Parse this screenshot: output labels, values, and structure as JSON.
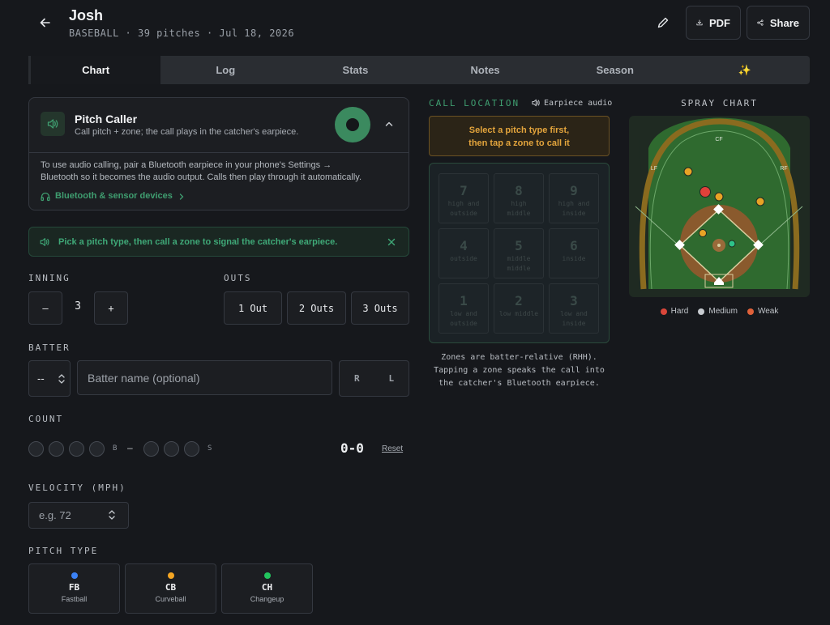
{
  "header": {
    "title": "Josh",
    "subtitle": "BASEBALL · 39 pitches · Jul 18, 2026",
    "pdf_label": "PDF",
    "share_label": "Share"
  },
  "tabs": [
    {
      "label": "Chart",
      "active": true
    },
    {
      "label": "Log"
    },
    {
      "label": "Stats"
    },
    {
      "label": "Notes"
    },
    {
      "label": "Season"
    },
    {
      "label": "✨"
    }
  ],
  "pitch_caller": {
    "title": "Pitch Caller",
    "subtitle": "Call pitch + zone; the call plays in the catcher's earpiece.",
    "body_line1": "To use audio calling, pair a Bluetooth earpiece in your phone's Settings →",
    "body_line2": "Bluetooth so it becomes the audio output. Calls then play through it automatically.",
    "bt_link": "Bluetooth & sensor devices"
  },
  "hint": {
    "text": "Pick a pitch type, then call a zone to signal the catcher's earpiece."
  },
  "inning": {
    "label": "INNING",
    "minus": "–",
    "value": "3",
    "plus": "+"
  },
  "outs": {
    "label": "OUTS",
    "options": [
      "1 Out",
      "2 Outs",
      "3 Outs"
    ]
  },
  "batter": {
    "label": "BATTER",
    "select_value": "--",
    "placeholder": "Batter name (optional)",
    "hand_r": "R",
    "hand_l": "L"
  },
  "count": {
    "label": "COUNT",
    "balls_letter": "B",
    "dash": "–",
    "strikes_letter": "S",
    "value": "0-0",
    "reset": "Reset"
  },
  "velocity": {
    "label": "VELOCITY (MPH)",
    "placeholder": "e.g. 72"
  },
  "pitch_type": {
    "label": "PITCH TYPE",
    "types": [
      {
        "code": "FB",
        "name": "Fastball",
        "color": "#3b82f6"
      },
      {
        "code": "CB",
        "name": "Curveball",
        "color": "#f5a623"
      },
      {
        "code": "CH",
        "name": "Changeup",
        "color": "#22c55e"
      }
    ]
  },
  "call_location": {
    "header": "CALL LOCATION",
    "earpiece": "Earpiece audio",
    "warn_line1": "Select a pitch type first,",
    "warn_line2": "then tap a zone to call it",
    "zones": [
      {
        "num": "7",
        "l1": "high and",
        "l2": "outside"
      },
      {
        "num": "8",
        "l1": "high",
        "l2": "middle"
      },
      {
        "num": "9",
        "l1": "high and",
        "l2": "inside"
      },
      {
        "num": "4",
        "l1": "outside",
        "l2": ""
      },
      {
        "num": "5",
        "l1": "middle",
        "l2": "middle"
      },
      {
        "num": "6",
        "l1": "inside",
        "l2": ""
      },
      {
        "num": "1",
        "l1": "low and",
        "l2": "outside"
      },
      {
        "num": "2",
        "l1": "low middle",
        "l2": ""
      },
      {
        "num": "3",
        "l1": "low and",
        "l2": "inside"
      }
    ],
    "note_line1": "Zones are batter-relative (RHH).",
    "note_line2": "Tapping a zone speaks the call into",
    "note_line3": "the catcher's Bluetooth earpiece."
  },
  "spray_chart": {
    "title": "SPRAY CHART",
    "cf_label": "CF",
    "lf_label": "LF",
    "rf_label": "RF",
    "legend": [
      {
        "label": "Hard",
        "color": "#d9463a"
      },
      {
        "label": "Medium",
        "color": "#c8ccd1"
      },
      {
        "label": "Weak",
        "color": "#e0613a"
      }
    ]
  },
  "colors": {
    "accent_green": "#3f9e70",
    "warn_orange": "#e3a43c"
  }
}
